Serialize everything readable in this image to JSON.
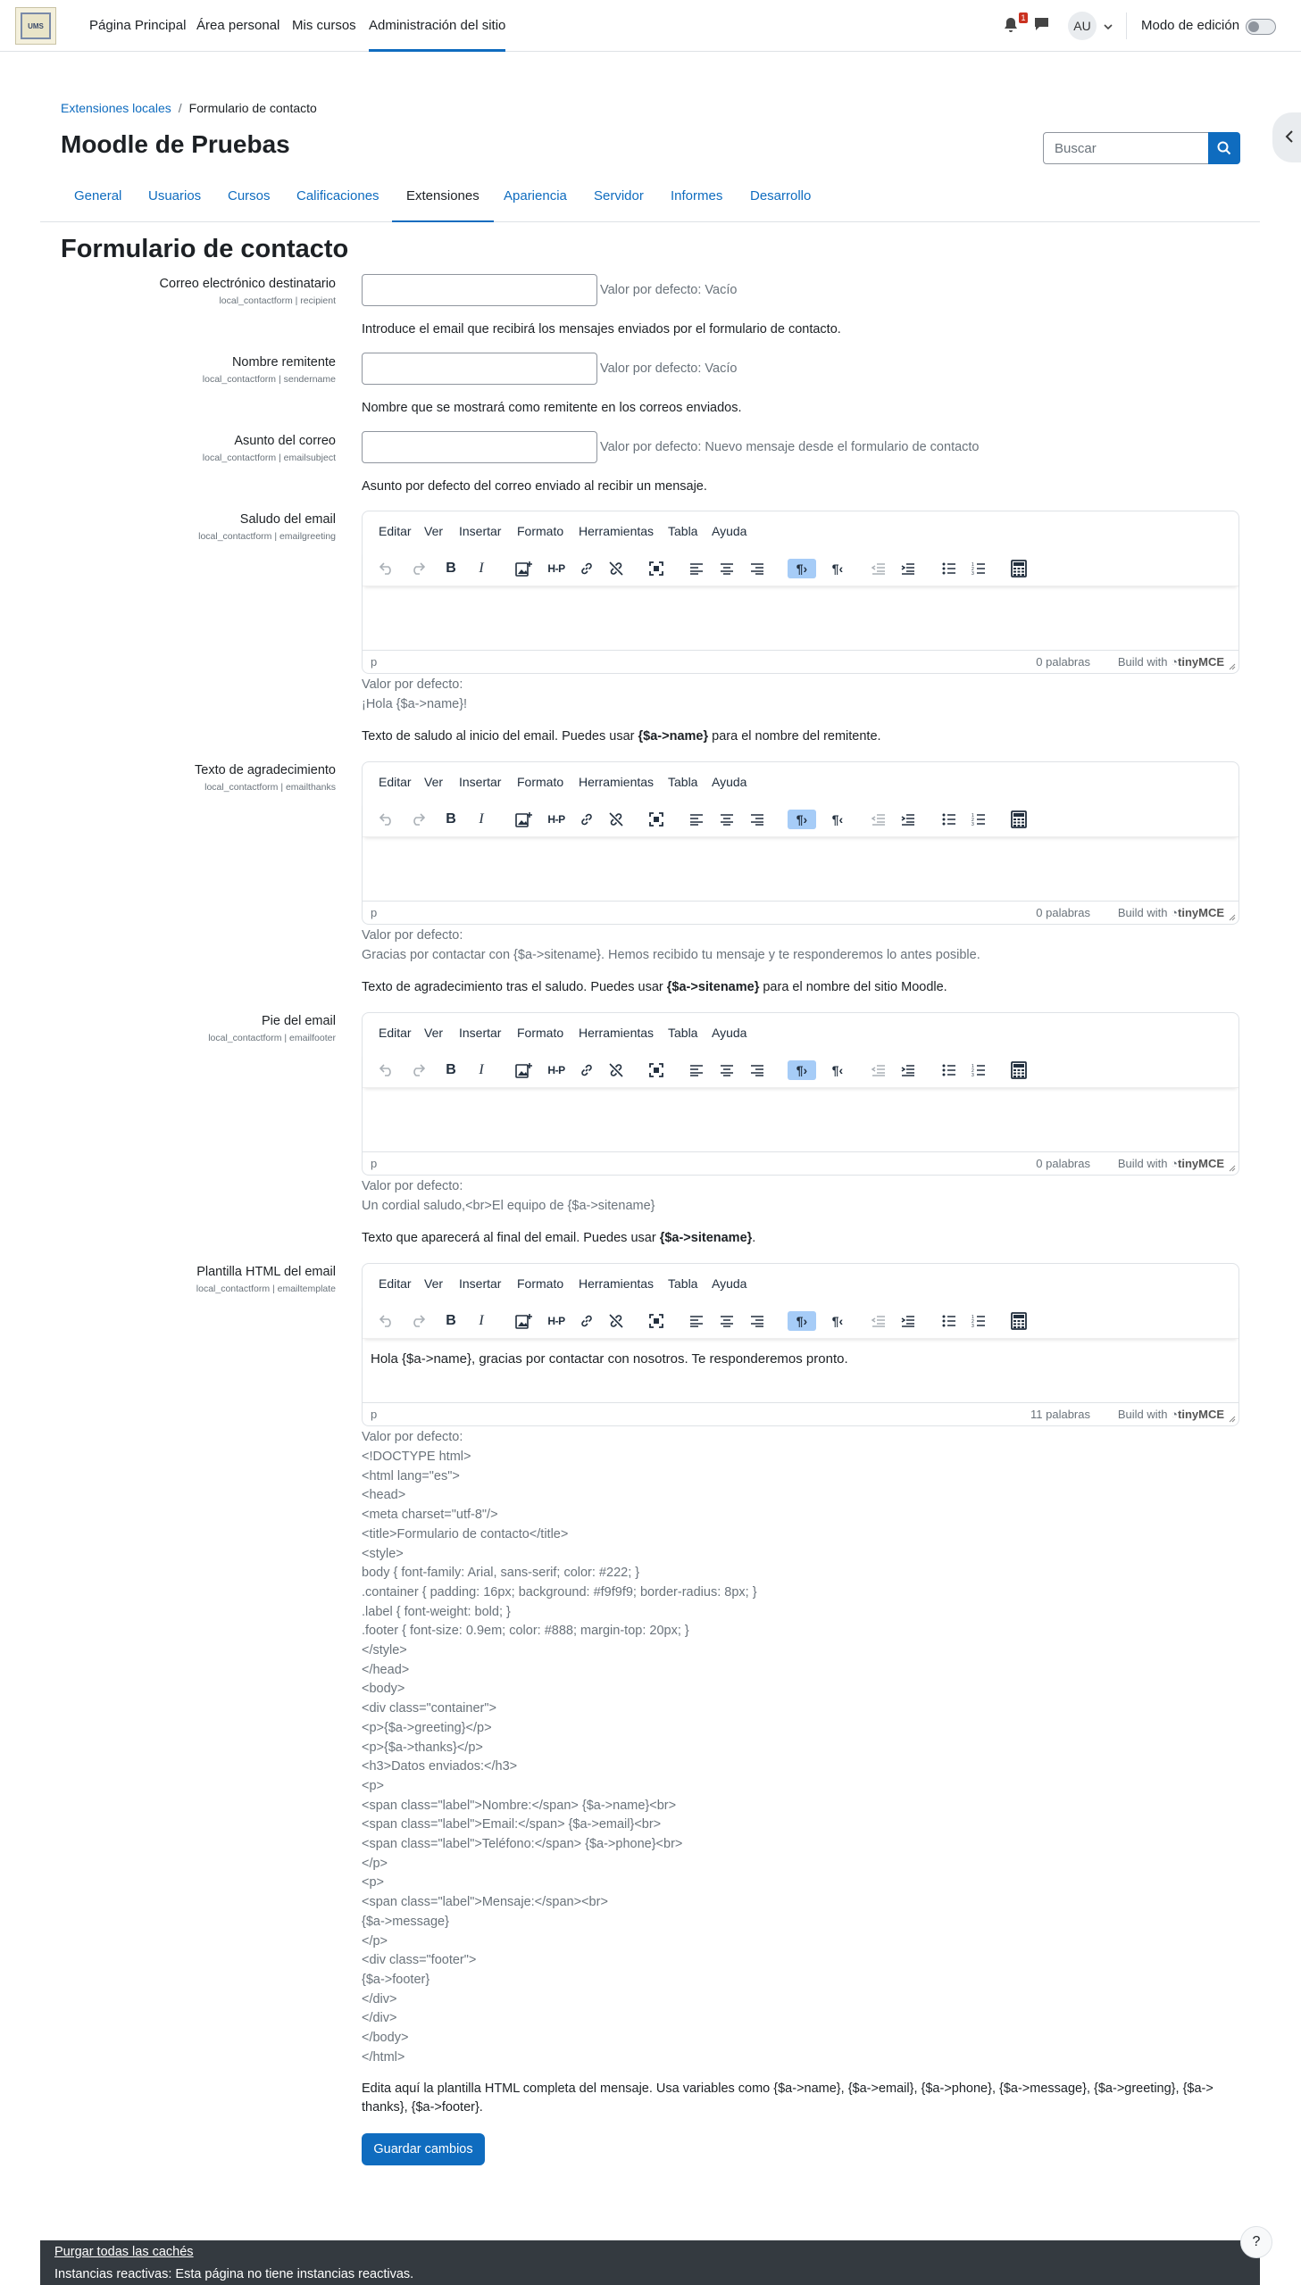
{
  "nav": {
    "logo_text": "UMS",
    "links": [
      "Página Principal",
      "Área personal",
      "Mis cursos",
      "Administración del sitio"
    ],
    "notification_count": "1",
    "avatar_initials": "AU",
    "edit_mode_label": "Modo de edición"
  },
  "header": {
    "breadcrumb_parent": "Extensiones locales",
    "breadcrumb_current": "Formulario de contacto",
    "site_title": "Moodle de Pruebas",
    "search_placeholder": "Buscar"
  },
  "tabs": [
    "General",
    "Usuarios",
    "Cursos",
    "Calificaciones",
    "Extensiones",
    "Apariencia",
    "Servidor",
    "Informes",
    "Desarrollo"
  ],
  "page_heading": "Formulario de contacto",
  "editor_menu": [
    "Editar",
    "Ver",
    "Insertar",
    "Formato",
    "Herramientas",
    "Tabla",
    "Ayuda"
  ],
  "editor_status": {
    "element": "p",
    "build_with": "Build with",
    "brand": "tinyMCE"
  },
  "settings": {
    "recipient": {
      "label": "Correo electrónico destinatario",
      "id": "local_contactform | recipient",
      "value": "",
      "default": "Valor por defecto: Vacío",
      "description": "Introduce el email que recibirá los mensajes enviados por el formulario de contacto."
    },
    "sendername": {
      "label": "Nombre remitente",
      "id": "local_contactform | sendername",
      "value": "",
      "default": "Valor por defecto: Vacío",
      "description": "Nombre que se mostrará como remitente en los correos enviados."
    },
    "emailsubject": {
      "label": "Asunto del correo",
      "id": "local_contactform | emailsubject",
      "value": "",
      "default": "Valor por defecto: Nuevo mensaje desde el formulario de contacto",
      "description": "Asunto por defecto del correo enviado al recibir un mensaje."
    },
    "emailgreeting": {
      "label": "Saludo del email",
      "id": "local_contactform | emailgreeting",
      "content": "",
      "word_count": "0 palabras",
      "default_label": "Valor por defecto:",
      "default_value": "¡Hola {$a->name}!",
      "desc_before": "Texto de saludo al inicio del email. Puedes usar ",
      "desc_bold": "{$a->name}",
      "desc_after": " para el nombre del remitente."
    },
    "emailthanks": {
      "label": "Texto de agradecimiento",
      "id": "local_contactform | emailthanks",
      "content": "",
      "word_count": "0 palabras",
      "default_label": "Valor por defecto:",
      "default_value": "Gracias por contactar con {$a->sitename}. Hemos recibido tu mensaje y te responderemos lo antes posible.",
      "desc_before": "Texto de agradecimiento tras el saludo. Puedes usar ",
      "desc_bold": "{$a->sitename}",
      "desc_after": " para el nombre del sitio Moodle."
    },
    "emailfooter": {
      "label": "Pie del email",
      "id": "local_contactform | emailfooter",
      "content": "",
      "word_count": "0 palabras",
      "default_label": "Valor por defecto:",
      "default_value": "Un cordial saludo,<br>El equipo de {$a->sitename}",
      "desc_before": "Texto que aparecerá al final del email. Puedes usar ",
      "desc_bold": "{$a->sitename}",
      "desc_after": "."
    },
    "emailtemplate": {
      "label": "Plantilla HTML del email",
      "id": "local_contactform | emailtemplate",
      "content": "Hola {$a->name}, gracias por contactar con nosotros. Te responderemos pronto.",
      "word_count": "11 palabras",
      "default_label": "Valor por defecto:",
      "default_lines": [
        "<!DOCTYPE html>",
        "<html lang=\"es\">",
        "<head>",
        "<meta charset=\"utf-8\"/>",
        "<title>Formulario de contacto</title>",
        "<style>",
        "body { font-family: Arial, sans-serif; color: #222; }",
        ".container { padding: 16px; background: #f9f9f9; border-radius: 8px; }",
        ".label { font-weight: bold; }",
        ".footer { font-size: 0.9em; color: #888; margin-top: 20px; }",
        "</style>",
        "</head>",
        "<body>",
        "<div class=\"container\">",
        "<p>{$a->greeting}</p>",
        "<p>{$a->thanks}</p>",
        "<h3>Datos enviados:</h3>",
        "<p>",
        "<span class=\"label\">Nombre:</span> {$a->name}<br>",
        "<span class=\"label\">Email:</span> {$a->email}<br>",
        "<span class=\"label\">Teléfono:</span> {$a->phone}<br>",
        "</p>",
        "<p>",
        "<span class=\"label\">Mensaje:</span><br>",
        "{$a->message}",
        "</p>",
        "<div class=\"footer\">",
        "{$a->footer}",
        "</div>",
        "</div>",
        "</body>",
        "</html>"
      ],
      "description_line1": "Edita aquí la plantilla HTML completa del mensaje. Usa variables como {$a->name}, {$a->email}, {$a->phone}, {$a->message}, {$a->greeting}, {$a->",
      "description_line2": "thanks}, {$a->footer}."
    }
  },
  "save_button": "Guardar cambios",
  "footer": {
    "purge_link": "Purgar todas las cachés",
    "reactive_text": "Instancias reactivas: Esta página no tiene instancias reactivas.",
    "help": "?"
  }
}
